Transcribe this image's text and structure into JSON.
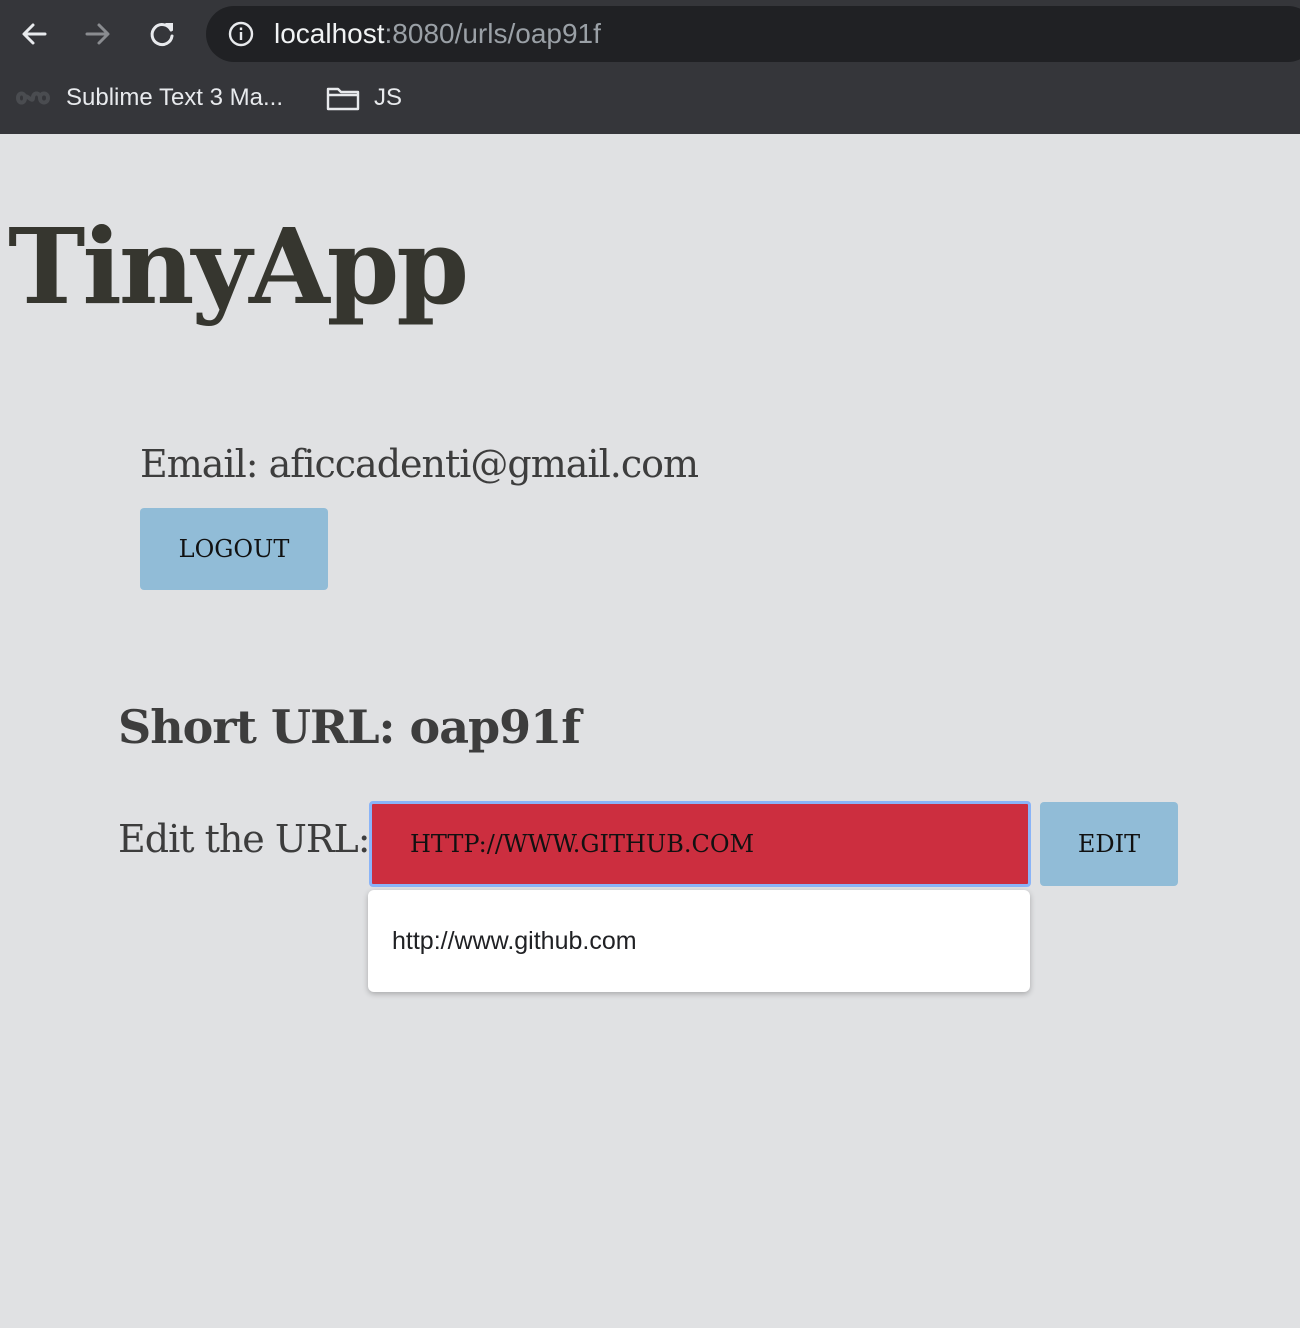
{
  "browser": {
    "url_host": "localhost",
    "url_rest": ":8080/urls/oap91f",
    "bookmarks": [
      {
        "label": "Sublime Text 3 Ma...",
        "icon": "infinity-icon"
      },
      {
        "label": "JS",
        "icon": "folder-icon"
      }
    ]
  },
  "page": {
    "title": "TinyApp",
    "email_line": "Email: aficcadenti@gmail.com",
    "logout_label": "LOGOUT",
    "short_url_heading": "Short URL: oap91f",
    "edit_label": "Edit the URL:",
    "url_input_value": "HTTP://WWW.GITHUB.COM",
    "edit_button_label": "EDIT",
    "autocomplete_suggestion": "http://www.github.com"
  },
  "colors": {
    "chrome_bg": "#35363a",
    "omnibox_bg": "#202124",
    "page_bg": "#e0e1e3",
    "button_bg": "#91bcd7",
    "input_bg": "#cc2e3f",
    "focus_ring": "#8ab4f8"
  }
}
